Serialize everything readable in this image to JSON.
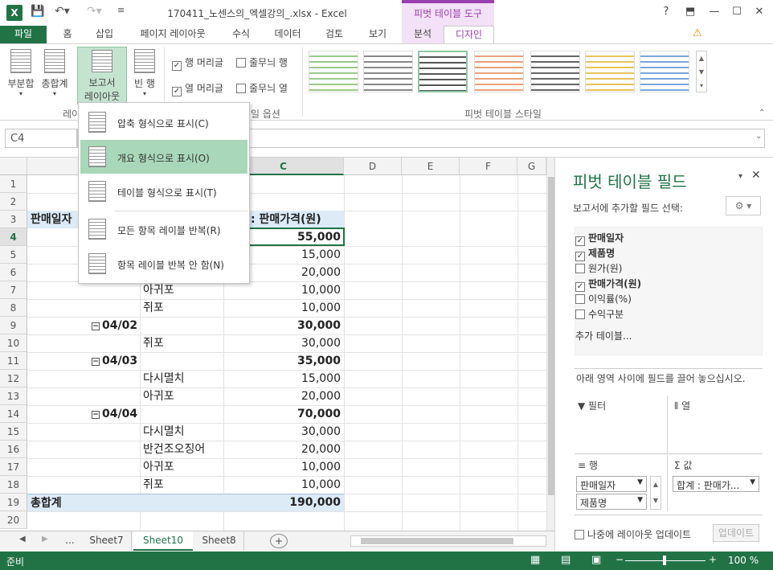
{
  "window": {
    "title": "170411_노센스의_엑셀강의_.xlsx - Excel",
    "context_tab_group": "피벗 테이블 도구",
    "help": "?",
    "minimize": "—",
    "restore": "☐",
    "close": "✕"
  },
  "tabs": [
    "파일",
    "홈",
    "삽입",
    "페이지 레이아웃",
    "수식",
    "데이터",
    "검토",
    "보기",
    "분석",
    "디자인"
  ],
  "ribbon": {
    "subtotal": "부분합",
    "grand_total": "총합계",
    "report_layout_1": "보고서",
    "report_layout_2": "레이아웃",
    "blank_rows_1": "빈 행",
    "row_headers": "행 머리글",
    "banded_rows": "줄무늬 행",
    "col_headers": "열 머리글",
    "banded_cols": "줄무늬 열",
    "group_layout_partial": "레이",
    "group_style_options_partial": "일 옵션",
    "group_pivot_styles": "피벗 테이블 스타일"
  },
  "formula_bar": {
    "name_box": "C4"
  },
  "menu": {
    "items": [
      "압축 형식으로 표시(C)",
      "개요 형식으로 표시(O)",
      "테이블 형식으로 표시(T)",
      "모든 항목 레이블 반복(R)",
      "항목 레이블 반복 안 함(N)"
    ]
  },
  "grid": {
    "columns": [
      "C",
      "D",
      "E",
      "F",
      "G"
    ],
    "rows": [
      "1",
      "2",
      "3",
      "4",
      "5",
      "6",
      "7",
      "8",
      "9",
      "10",
      "11",
      "12",
      "13",
      "14",
      "15",
      "16",
      "17",
      "18",
      "19",
      "20"
    ],
    "header_row": {
      "a": "판매일자",
      "c": ": 판매가격(원)"
    },
    "cells": [
      {
        "b": "",
        "c": "55,000"
      },
      {
        "b": "",
        "c": "15,000"
      },
      {
        "b": "",
        "c": "20,000"
      },
      {
        "b": "아귀포",
        "c": "10,000"
      },
      {
        "b": "쥐포",
        "c": "10,000"
      },
      {
        "b": "04/02",
        "c": "30,000",
        "group": true
      },
      {
        "b": "쥐포",
        "c": "30,000"
      },
      {
        "b": "04/03",
        "c": "35,000",
        "group": true
      },
      {
        "b": "다시멸치",
        "c": "15,000"
      },
      {
        "b": "아귀포",
        "c": "20,000"
      },
      {
        "b": "04/04",
        "c": "70,000",
        "group": true
      },
      {
        "b": "다시멸치",
        "c": "30,000"
      },
      {
        "b": "반건조오징어",
        "c": "20,000"
      },
      {
        "b": "아귀포",
        "c": "10,000"
      },
      {
        "b": "쥐포",
        "c": "10,000"
      }
    ],
    "grand_total_label": "총합계",
    "grand_total_value": "190,000"
  },
  "sheets": {
    "more": "...",
    "tabs": [
      "Sheet7",
      "Sheet10",
      "Sheet8"
    ],
    "add": "+"
  },
  "status": {
    "ready": "준비",
    "zoom": "100 %"
  },
  "panel": {
    "title": "피벗 테이블 필드",
    "choose": "보고서에 추가할 필드 선택:",
    "fields": [
      {
        "name": "판매일자",
        "checked": true
      },
      {
        "name": "제품명",
        "checked": true
      },
      {
        "name": "원가(원)",
        "checked": false
      },
      {
        "name": "판매가격(원)",
        "checked": true
      },
      {
        "name": "이익률(%)",
        "checked": false
      },
      {
        "name": "수익구분",
        "checked": false
      }
    ],
    "more_tables": "추가 테이블...",
    "drag_hint": "아래 영역 사이에 필드를 끌어 놓으십시오.",
    "filters": "필터",
    "columns": "열",
    "rows": "행",
    "values": "값",
    "row_field_1": "판매일자",
    "row_field_2": "제품명",
    "value_field": "합계 : 판매가...",
    "defer": "나중에 레이아웃 업데이트",
    "update": "업데이트"
  },
  "colors": {
    "excel_green": "#217346",
    "context_purple": "#9a3fae",
    "pivot_header": "#ddebf7",
    "menu_highlight": "#a8d8b9"
  }
}
